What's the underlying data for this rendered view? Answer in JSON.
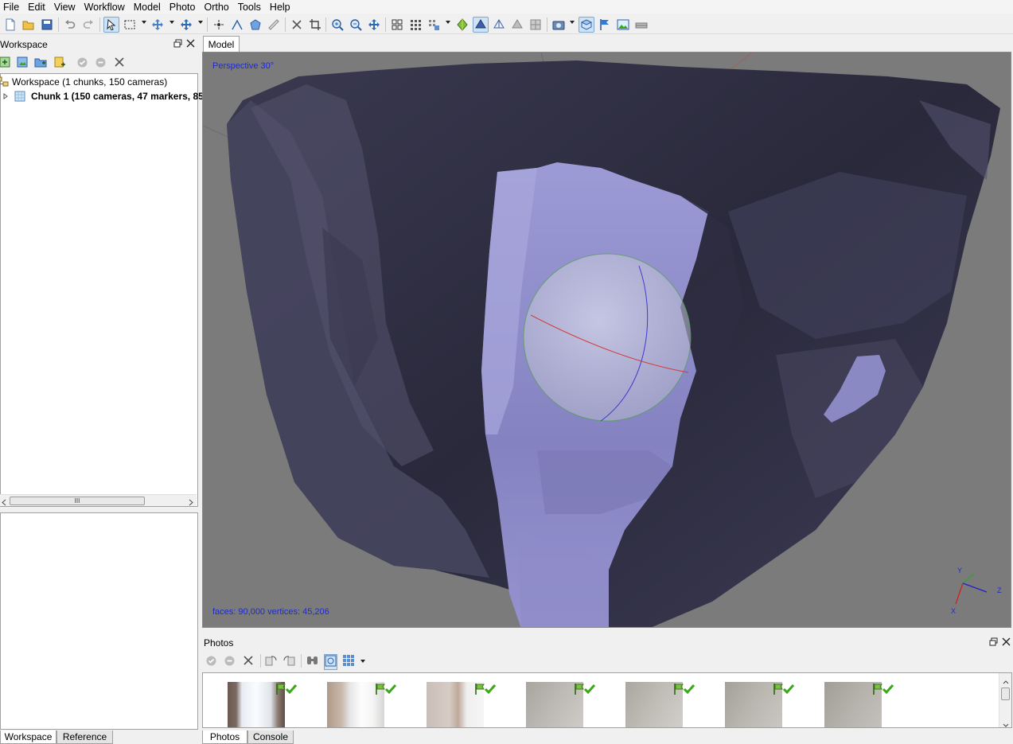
{
  "menu": [
    "File",
    "Edit",
    "View",
    "Workflow",
    "Model",
    "Photo",
    "Ortho",
    "Tools",
    "Help"
  ],
  "workspace_panel": {
    "title": "Workspace",
    "tree": {
      "root_label": "Workspace (1 chunks, 150 cameras)",
      "chunk_label": "Chunk 1 (150 cameras, 47 markers, 85"
    },
    "hscroll_grip": "III"
  },
  "bottom_tabs_left": [
    "Workspace",
    "Reference"
  ],
  "model": {
    "tab_label": "Model",
    "projection": "Perspective 30°",
    "stats": "faces: 90,000 vertices: 45,206",
    "axes": {
      "x": "X",
      "y": "Y",
      "z": "Z"
    }
  },
  "photos_panel": {
    "title": "Photos",
    "thumb_count": 7
  },
  "bottom_tabs_right": [
    "Photos",
    "Console"
  ],
  "colors": {
    "viewport_bg": "#7b7b7b",
    "mesh_dark": "#2c2b3e",
    "mesh_light": "#8a89c4",
    "accent_text": "#1e2cc8",
    "check_green": "#3aa81a"
  }
}
